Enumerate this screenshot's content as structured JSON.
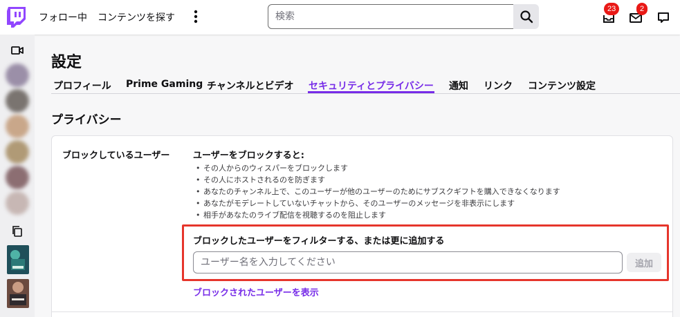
{
  "topnav": {
    "following_label": "フォロー中",
    "browse_label": "コンテンツを探す",
    "search_placeholder": "検索",
    "notifications_badge": "23",
    "inbox_badge": "2",
    "icons": [
      "twitch-logo-icon",
      "more-vertical-icon",
      "search-icon",
      "notifications-icon",
      "inbox-icon",
      "whispers-icon"
    ],
    "brand_color": "#9146ff"
  },
  "sidebar": {
    "icons": [
      "video-camera-icon",
      "copy-icon"
    ],
    "avatar_count": 7
  },
  "page": {
    "title": "設定",
    "tabs": [
      {
        "label": "プロフィール",
        "active": false
      },
      {
        "label": "Prime Gaming",
        "active": false
      },
      {
        "label": "チャンネルとビデオ",
        "active": false
      },
      {
        "label": "セキュリティとプライバシー",
        "active": true
      },
      {
        "label": "通知",
        "active": false
      },
      {
        "label": "リンク",
        "active": false
      },
      {
        "label": "コンテンツ設定",
        "active": false
      }
    ],
    "section_title": "プライバシー",
    "accent_color": "#772ce8"
  },
  "blocked_users": {
    "row_label": "ブロックしているユーザー",
    "heading": "ユーザーをブロックすると:",
    "bullets": [
      "その人からのウィスパーをブロックします",
      "その人にホストされるのを防ぎます",
      "あなたのチャンネル上で、このユーザーが他のユーザーのためにサブスクギフトを購入できなくなります",
      "あなたがモデレートしていないチャットから、そのユーザーのメッセージを非表示にします",
      "相手があなたのライブ配信を視聴するのを阻止します"
    ],
    "filter_label": "ブロックしたユーザーをフィルターする、または更に追加する",
    "input_placeholder": "ユーザー名を入力してください",
    "add_button": "追加",
    "view_link": "ブロックされたユーザーを表示",
    "highlight_color": "#e6352b"
  }
}
